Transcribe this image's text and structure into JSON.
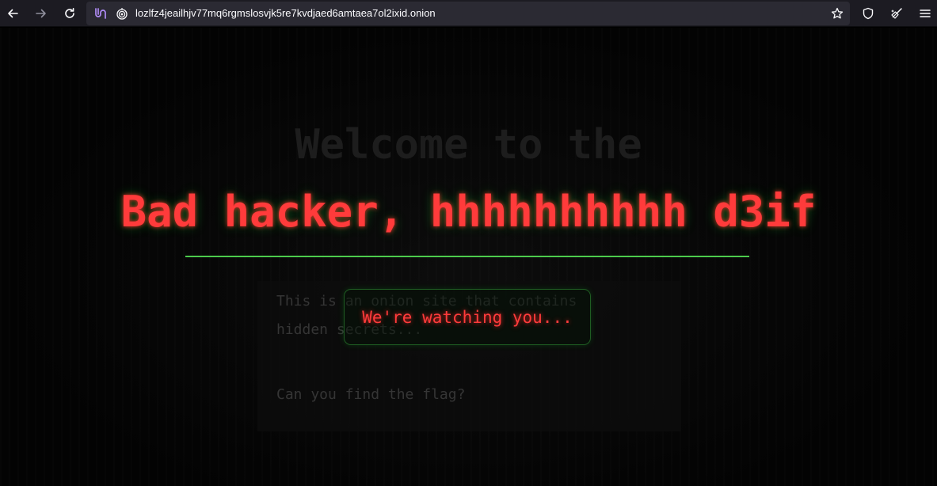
{
  "browser": {
    "url": "lozlfz4jeailhjv77mq6rgmslosvjk5re7kvdjaed6amtaea7ol2ixid.onion",
    "icons": {
      "back": "back-arrow-icon",
      "forward": "forward-arrow-icon",
      "reload": "reload-icon",
      "circuit": "tor-circuit-icon",
      "onion": "onion-icon",
      "bookmark": "star-icon",
      "shield": "shield-icon",
      "new_identity": "broom-icon",
      "menu": "hamburger-menu-icon"
    }
  },
  "page": {
    "welcome_line": "Welcome to the",
    "overlay_message": "Bad hacker, hhhhhhhhhh d3if",
    "paragraph_1_line_1": "This is an onion site that contains",
    "paragraph_1_line_2": "hidden secrets...",
    "paragraph_2": "Can you find the flag?",
    "popup_message": "We're watching you...",
    "colors": {
      "alert_red": "#ff3b3b",
      "divider_green": "#4ccb4c",
      "background": "#030303"
    }
  }
}
